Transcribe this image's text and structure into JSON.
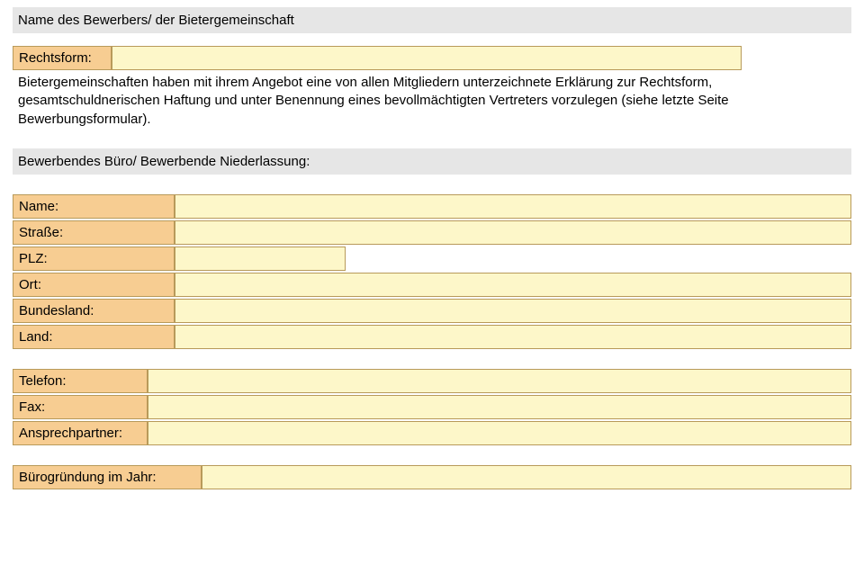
{
  "section1": {
    "title": "Name des Bewerbers/ der Bietergemeinschaft"
  },
  "rechtsform": {
    "label": "Rechtsform:",
    "value": ""
  },
  "paragraph": "Bietergemeinschaften haben mit ihrem Angebot eine von allen Mitgliedern unterzeichnete Erklärung zur Rechtsform, gesamtschuldnerischen Haftung und unter Benennung eines bevollmächtigten Vertreters vorzulegen (siehe letzte Seite Bewerbungsformular).",
  "section2": {
    "title": "Bewerbendes Büro/ Bewerbende Niederlassung:"
  },
  "fields": {
    "name": {
      "label": "Name:",
      "value": ""
    },
    "strasse": {
      "label": "Straße:",
      "value": ""
    },
    "plz": {
      "label": "PLZ:",
      "value": ""
    },
    "ort": {
      "label": "Ort:",
      "value": ""
    },
    "bundesland": {
      "label": "Bundesland:",
      "value": ""
    },
    "land": {
      "label": "Land:",
      "value": ""
    },
    "telefon": {
      "label": "Telefon:",
      "value": ""
    },
    "fax": {
      "label": "Fax:",
      "value": ""
    },
    "ansprechpartner": {
      "label": "Ansprechpartner:",
      "value": ""
    },
    "buerogruendung": {
      "label": "Bürogründung  im Jahr:",
      "value": ""
    }
  }
}
